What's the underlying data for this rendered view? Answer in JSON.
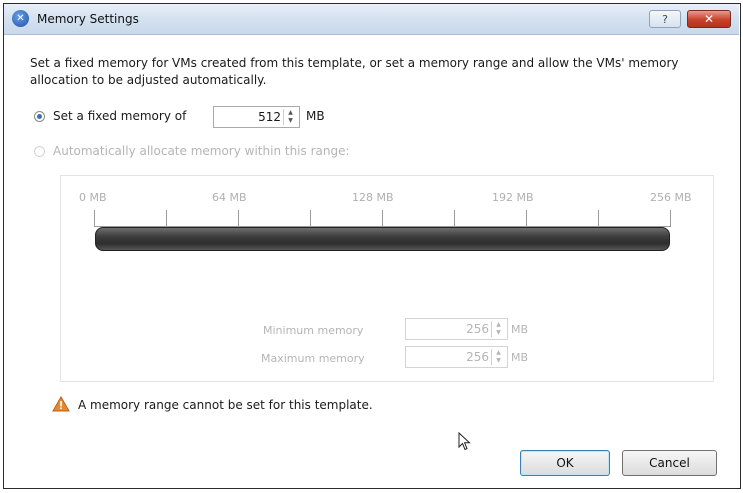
{
  "window": {
    "title": "Memory Settings",
    "help_label": "?",
    "close_label": "✕"
  },
  "description": "Set a fixed memory for VMs created from this template, or set a memory range and allow the VMs' memory allocation to be adjusted automatically.",
  "fixed_option": {
    "label": "Set a fixed memory of",
    "selected": true,
    "value": "512",
    "unit": "MB"
  },
  "auto_option": {
    "label": "Automatically allocate memory within this range:",
    "selected": false,
    "enabled": false
  },
  "range_scale": {
    "ticks": [
      "0 MB",
      "64 MB",
      "128 MB",
      "192 MB",
      "256 MB"
    ]
  },
  "minimum_memory": {
    "label": "Minimum memory",
    "value": "256",
    "unit": "MB"
  },
  "maximum_memory": {
    "label": "Maximum memory",
    "value": "256",
    "unit": "MB"
  },
  "warning": {
    "icon": "warning-triangle-icon",
    "text": "A memory range cannot be set for this template."
  },
  "buttons": {
    "ok": "OK",
    "cancel": "Cancel"
  },
  "colors": {
    "accent": "#3c6fb0",
    "warning": "#e8892b",
    "close": "#c8412b"
  }
}
